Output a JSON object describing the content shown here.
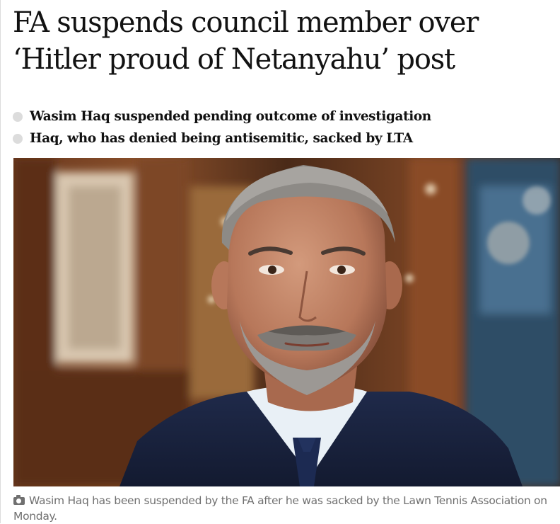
{
  "article": {
    "headline": "FA suspends council member over ‘Hitler proud of Netanyahu’ post",
    "standfirst": [
      "Wasim Haq suspended pending outcome of investigation",
      "Haq, who has denied being antisemitic, sacked by LTA"
    ],
    "image": {
      "subject": "man-portrait",
      "caption": "Wasim Haq has been suspended by the FA after he was sacked by the Lawn Tennis Association on Monday."
    }
  },
  "icons": {
    "bullet": "bullet-dot-icon",
    "caption": "camera-icon"
  },
  "colors": {
    "text": "#121212",
    "caption": "#707070",
    "bullet": "#dcdcdc"
  }
}
